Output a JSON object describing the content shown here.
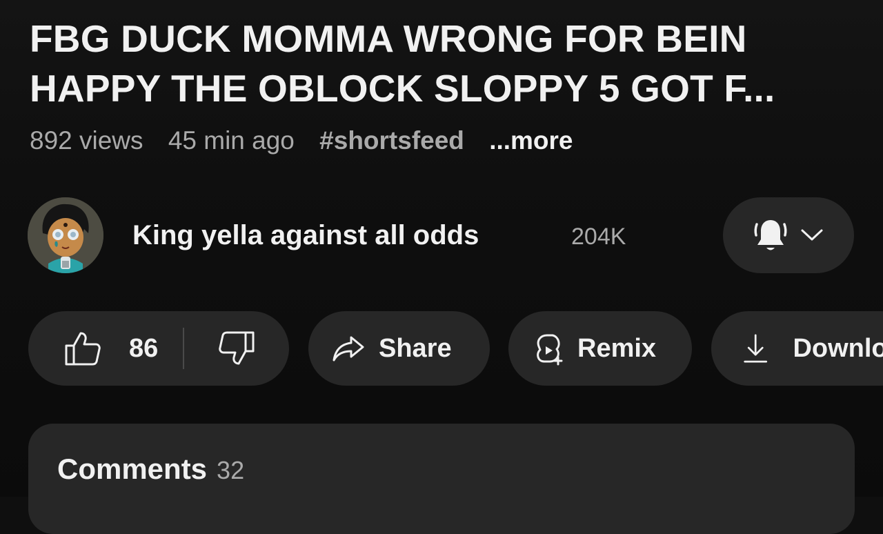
{
  "video": {
    "title": "FBG DUCK MOMMA WRONG FOR BEIN HAPPY THE OBLOCK SLOPPY 5 GOT F...",
    "views": "892 views",
    "age": "45 min ago",
    "hashtag": "#shortsfeed",
    "more": "...more"
  },
  "channel": {
    "name": "King yella against all odds",
    "subscribers": "204K",
    "avatar_icon": "cartoon-avatar",
    "bell_icon": "bell-icon",
    "dropdown_icon": "chevron-down-icon"
  },
  "actions": {
    "like_count": "86",
    "share_label": "Share",
    "remix_label": "Remix",
    "download_label": "Download"
  },
  "comments": {
    "label": "Comments",
    "count": "32"
  },
  "colors": {
    "background": "#0f0f0f",
    "pill": "#272727",
    "text_primary": "#f1f1f1",
    "text_secondary": "#aaaaaa"
  }
}
